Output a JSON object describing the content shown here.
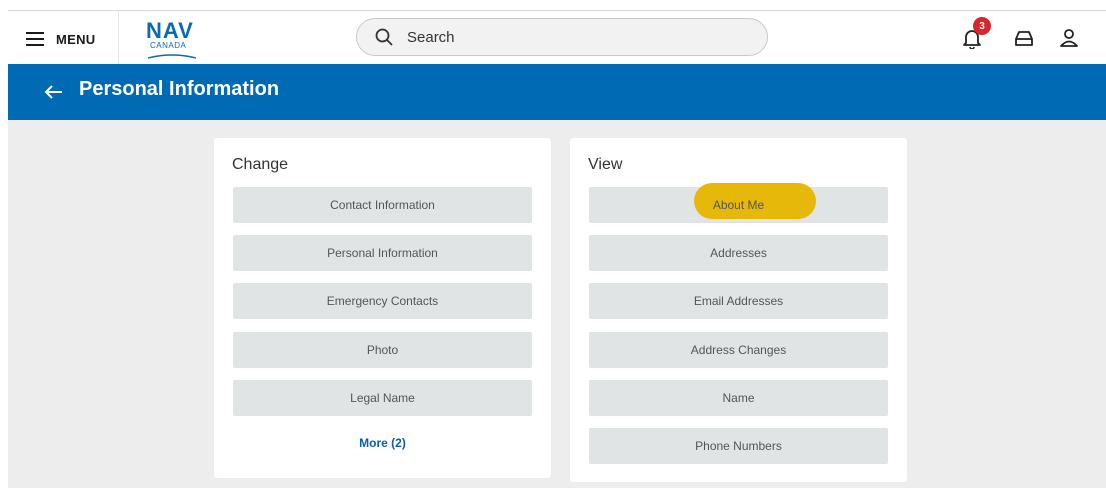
{
  "topbar": {
    "menu_label": "MENU",
    "logo_top": "NAV",
    "logo_bottom": "CANADA",
    "search_placeholder": "Search",
    "notifications_count": "3"
  },
  "header": {
    "title": "Personal Information"
  },
  "change": {
    "title": "Change",
    "items": [
      "Contact Information",
      "Personal Information",
      "Emergency Contacts",
      "Photo",
      "Legal Name"
    ],
    "more_label": "More (2)"
  },
  "view": {
    "title": "View",
    "items": [
      "About Me",
      "Addresses",
      "Email Addresses",
      "Address Changes",
      "Name",
      "Phone Numbers"
    ]
  },
  "colors": {
    "brand_blue": "#006ab4",
    "highlight": "#e5b80a",
    "badge_red": "#d8262d"
  }
}
